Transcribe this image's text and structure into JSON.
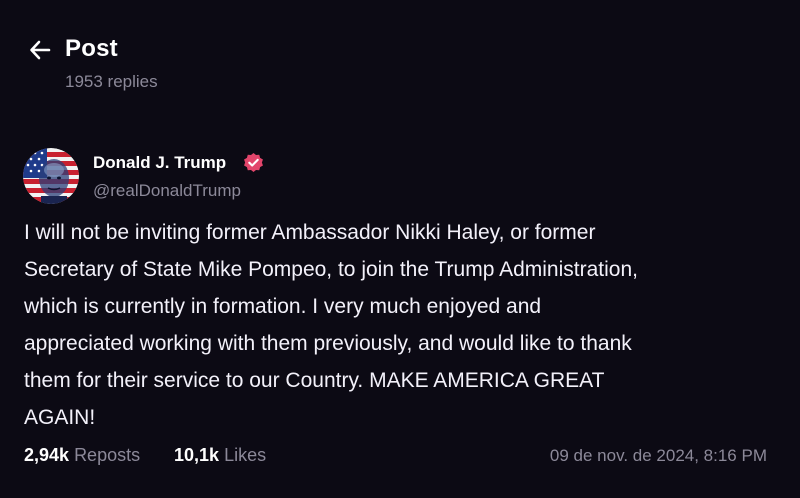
{
  "header": {
    "title": "Post",
    "replies": "1953 replies",
    "back_icon": "arrow-left-icon"
  },
  "author": {
    "name": "Donald J. Trump",
    "handle": "@realDonaldTrump",
    "verified_icon": "verified-check-icon",
    "verified_color": "#e2456b",
    "avatar_icon": "flag-portrait-avatar"
  },
  "post": {
    "text": "I will not be inviting former Ambassador Nikki Haley, or former\nSecretary of State Mike Pompeo, to join the Trump Administration,\nwhich is currently in formation. I very much enjoyed and\nappreciated working with them previously, and would like to thank\nthem for their service to our Country. MAKE AMERICA GREAT\nAGAIN!"
  },
  "stats": {
    "reposts_count": "2,94k",
    "reposts_label": "Reposts",
    "likes_count": "10,1k",
    "likes_label": "Likes",
    "timestamp": "09 de nov. de 2024, 8:16 PM"
  },
  "colors": {
    "background": "#0c0a14",
    "text_primary": "#ffffff",
    "text_secondary": "#8c8999",
    "accent": "#e2456b"
  }
}
